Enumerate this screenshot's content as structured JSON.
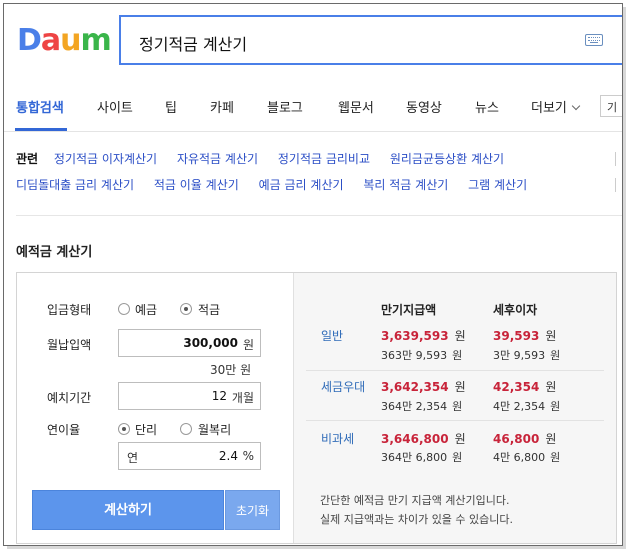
{
  "header": {
    "logo": [
      "D",
      "a",
      "u",
      "m"
    ],
    "logo_colors": [
      "#4a7fe8",
      "#ee4444",
      "#f3a522",
      "#3ab54a"
    ],
    "search_value": "정기적금 계산기"
  },
  "nav": {
    "tabs": [
      "통합검색",
      "사이트",
      "팁",
      "카페",
      "블로그",
      "웹문서",
      "동영상",
      "뉴스",
      "더보기"
    ],
    "cut_label": "기"
  },
  "related": {
    "title": "관련",
    "row1": [
      "정기적금 이자계산기",
      "자유적금 계산기",
      "정기적금 금리비교",
      "원리금균등상환 계산기"
    ],
    "row2": [
      "디딤돌대출 금리 계산기",
      "적금 이율 계산기",
      "예금 금리 계산기",
      "복리 적금 계산기",
      "그램 계산기"
    ]
  },
  "calculator": {
    "title": "예적금 계산기",
    "deposit_type_label": "입금형태",
    "deposit_opt1": "예금",
    "deposit_opt2": "적금",
    "monthly_label": "월납입액",
    "monthly_value": "300,000",
    "monthly_unit": "원",
    "monthly_hint": "30만 원",
    "period_label": "예치기간",
    "period_value": "12",
    "period_unit": "개월",
    "rate_label": "연이율",
    "rate_opt1": "단리",
    "rate_opt2": "월복리",
    "rate_prefix": "연",
    "rate_value": "2.4",
    "rate_unit": "%",
    "calc_button": "계산하기",
    "reset_button": "초기화"
  },
  "results": {
    "col1": "만기지급액",
    "col2": "세후이자",
    "rows": [
      {
        "label": "일반",
        "total": "3,639,593",
        "total_kr": "363만 9,593",
        "interest": "39,593",
        "interest_kr": "3만 9,593"
      },
      {
        "label": "세금우대",
        "total": "3,642,354",
        "total_kr": "364만 2,354",
        "interest": "42,354",
        "interest_kr": "4만 2,354"
      },
      {
        "label": "비과세",
        "total": "3,646,800",
        "total_kr": "364만 6,800",
        "interest": "46,800",
        "interest_kr": "4만 6,800"
      }
    ],
    "unit": "원",
    "note1": "간단한 예적금 만기 지급액 계산기입니다.",
    "note2": "실제 지급액과는 차이가 있을 수 있습니다."
  }
}
